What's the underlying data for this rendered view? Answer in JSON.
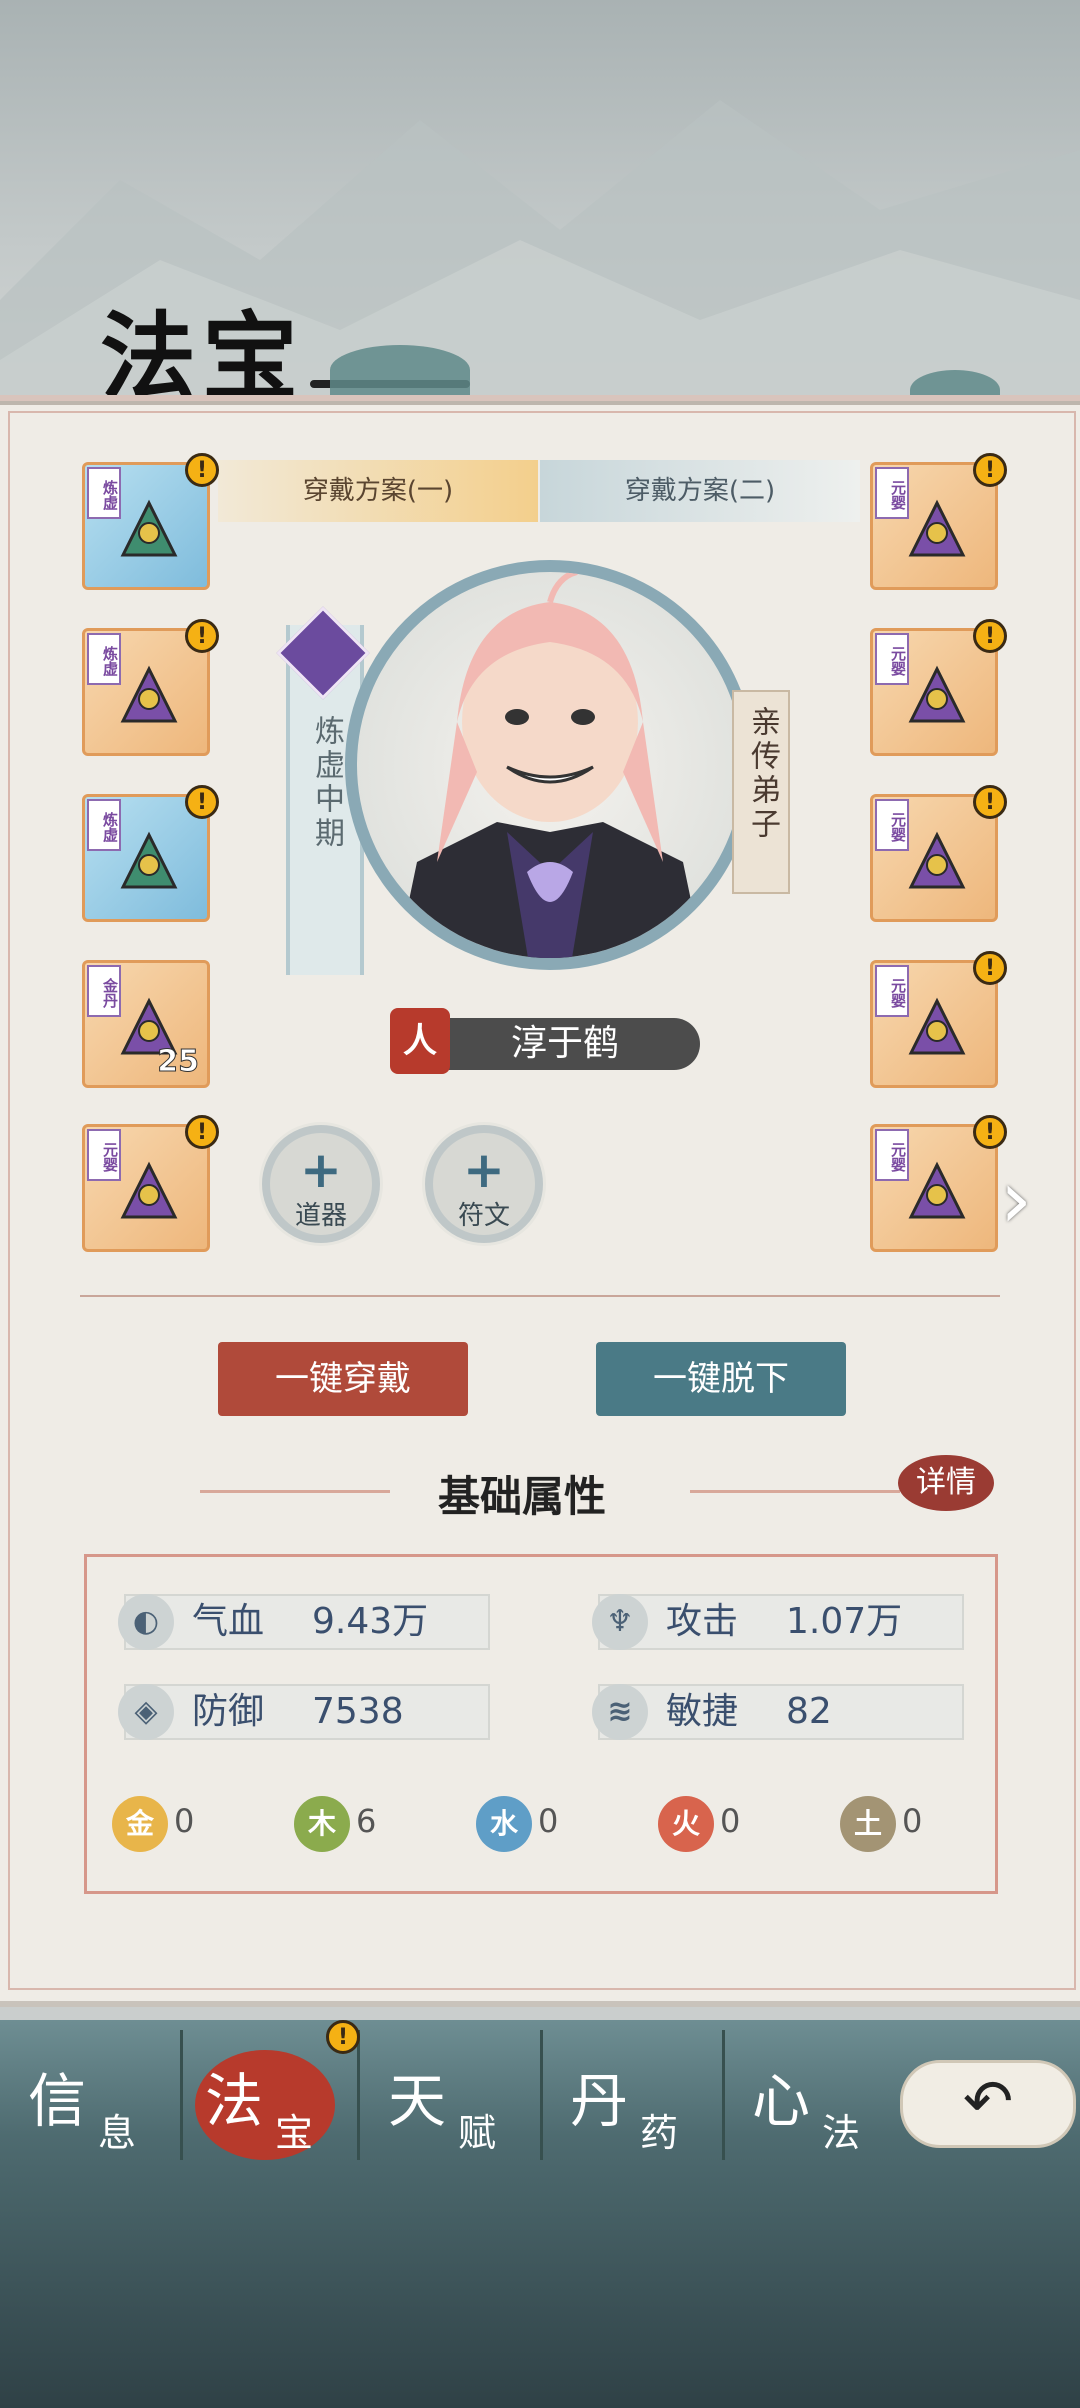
{
  "page": {
    "title": "法宝"
  },
  "scheme_tabs": [
    "穿戴方案(一)",
    "穿戴方案(二)"
  ],
  "left_slots": [
    {
      "grade": "炼虚",
      "style": "blue",
      "alert": true,
      "item": "jade-dagger-icon"
    },
    {
      "grade": "炼虚",
      "style": "orange",
      "alert": true,
      "item": "curved-blade-icon"
    },
    {
      "grade": "炼虚",
      "style": "blue",
      "alert": true,
      "item": "jade-dagger-icon"
    },
    {
      "grade": "金丹",
      "style": "orange",
      "alert": false,
      "item": "purple-armor-icon",
      "count": "25"
    },
    {
      "grade": "元婴",
      "style": "orange",
      "alert": true,
      "item": "boots-icon"
    }
  ],
  "right_slots": [
    {
      "grade": "元婴",
      "style": "orange",
      "alert": true,
      "item": "helmet-icon"
    },
    {
      "grade": "元婴",
      "style": "orange",
      "alert": true,
      "item": "amulet-icon"
    },
    {
      "grade": "元婴",
      "style": "orange",
      "alert": true,
      "item": "bracer-icon"
    },
    {
      "grade": "元婴",
      "style": "orange",
      "alert": true,
      "item": "crown-icon"
    },
    {
      "grade": "元婴",
      "style": "orange",
      "alert": true,
      "item": "ring-icon"
    }
  ],
  "character": {
    "realm": "炼虚中期",
    "role": "亲传弟子",
    "race_seal": "人",
    "name": "淳于鹤"
  },
  "add_buttons": [
    {
      "label": "道器",
      "icon": "+"
    },
    {
      "label": "符文",
      "icon": "+"
    }
  ],
  "actions": {
    "equip_all": "一键穿戴",
    "unequip_all": "一键脱下"
  },
  "attributes": {
    "section_title": "基础属性",
    "detail": "详情",
    "stats": [
      {
        "label": "气血",
        "value": "9.43万",
        "icon": "drop-icon"
      },
      {
        "label": "攻击",
        "value": "1.07万",
        "icon": "attack-icon"
      },
      {
        "label": "防御",
        "value": "7538",
        "icon": "shield-icon"
      },
      {
        "label": "敏捷",
        "value": "82",
        "icon": "wind-icon"
      }
    ],
    "elements": [
      {
        "name": "金",
        "value": "0",
        "color": "#e8b54a"
      },
      {
        "name": "木",
        "value": "6",
        "color": "#8bab4d"
      },
      {
        "name": "水",
        "value": "0",
        "color": "#5f9ec7"
      },
      {
        "name": "火",
        "value": "0",
        "color": "#d8644d"
      },
      {
        "name": "土",
        "value": "0",
        "color": "#a39474"
      }
    ]
  },
  "bottom_nav": [
    {
      "big": "信",
      "small": "息",
      "active": false
    },
    {
      "big": "法",
      "small": "宝",
      "active": true
    },
    {
      "big": "天",
      "small": "赋",
      "active": false
    },
    {
      "big": "丹",
      "small": "药",
      "active": false
    },
    {
      "big": "心",
      "small": "法",
      "active": false
    }
  ],
  "colors": {
    "slot_border": "#e09b5a",
    "grade_purple": "#7a4aa0",
    "equip_btn": "#b04a3a",
    "unequip_btn": "#4a7a86",
    "active_tab": "#b73a2c"
  }
}
